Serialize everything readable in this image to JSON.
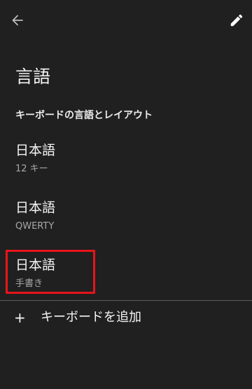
{
  "header": {
    "back_icon": "arrow-left-icon",
    "edit_icon": "pencil-icon"
  },
  "page": {
    "title": "言語",
    "section_header": "キーボードの言語とレイアウト"
  },
  "keyboards": [
    {
      "title": "日本語",
      "subtitle": "12 キー"
    },
    {
      "title": "日本語",
      "subtitle": "QWERTY"
    },
    {
      "title": "日本語",
      "subtitle": "手書き"
    }
  ],
  "add_keyboard": {
    "icon": "+",
    "label": "キーボードを追加"
  },
  "colors": {
    "background": "#202020",
    "highlight": "#e8141b",
    "text_primary": "#f5f5f5",
    "text_secondary": "#a8a8a8",
    "divider": "#5c5c5c"
  }
}
